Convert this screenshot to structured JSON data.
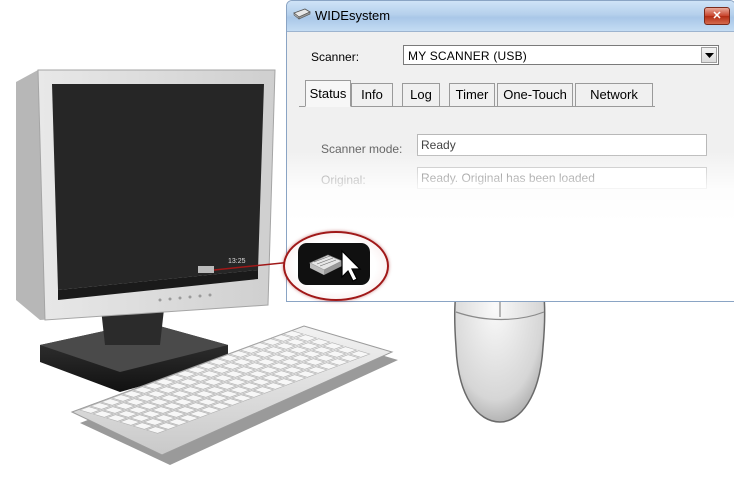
{
  "window": {
    "title": "WIDEsystem",
    "close_glyph": "✕"
  },
  "scanner": {
    "label": "Scanner:",
    "selected": "MY SCANNER (USB)"
  },
  "tabs": [
    {
      "label": "Status",
      "active": true
    },
    {
      "label": "Info",
      "active": false
    },
    {
      "label": "Log",
      "active": false
    },
    {
      "label": "Timer",
      "active": false
    },
    {
      "label": "One-Touch",
      "active": false
    },
    {
      "label": "Network",
      "active": false
    }
  ],
  "status": {
    "mode_label": "Scanner mode:",
    "mode_value": "Ready",
    "original_label": "Original:",
    "original_value": "Ready. Original has been loaded"
  },
  "monitor": {
    "taskbar_clock": "13:25"
  },
  "icons": {
    "app_icon": "scanner-icon",
    "callout": "tray-scanner-icon",
    "cursor": "mouse-pointer-icon"
  },
  "colors": {
    "callout_ring": "#a01818",
    "mouse_button_highlight": "#e0141a"
  }
}
